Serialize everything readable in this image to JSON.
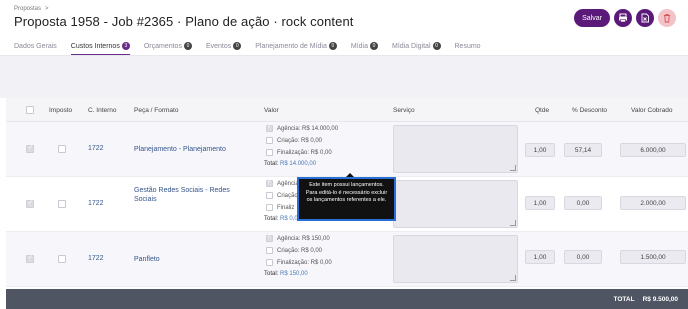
{
  "breadcrumb": {
    "label": "Propostas",
    "separator": ">"
  },
  "page": {
    "title": "Proposta 1958 - Job #2365 · Plano de ação · rock content"
  },
  "actions": {
    "save_label": "Salvar"
  },
  "tabs": [
    {
      "label": "Dados Gerais",
      "badge": ""
    },
    {
      "label": "Custos Internos",
      "badge": "3"
    },
    {
      "label": "Orçamentos",
      "badge": "0"
    },
    {
      "label": "Eventos",
      "badge": "0"
    },
    {
      "label": "Planejamento de Mídia",
      "badge": "0"
    },
    {
      "label": "Mídia",
      "badge": "0"
    },
    {
      "label": "Mídia Digital",
      "badge": "0"
    },
    {
      "label": "Resumo",
      "badge": ""
    }
  ],
  "table": {
    "headers": {
      "imposto": "Imposto",
      "c_interno": "C. Interno",
      "peca": "Peça / Formato",
      "valor": "Valor",
      "servico": "Serviço",
      "qtde": "Qtde",
      "desconto": "% Desconto",
      "valor_cobrado": "Valor Cobrado"
    },
    "rows": [
      {
        "code": "1722",
        "peca": "Planejamento - Planejamento",
        "agencia": "Agência: R$ 14.000,00",
        "criacao": "Criação: R$ 0,00",
        "finalizacao": "Finalização: R$ 0,00",
        "total_label": "Total:",
        "total": "R$ 14.000,00",
        "qtde": "1,00",
        "desconto": "57,14",
        "valor_cobrado": "6.000,00"
      },
      {
        "code": "1722",
        "peca": "Gestão Redes Sociais - Redes Sociais",
        "agencia": "Agência",
        "criacao": "Criação",
        "finalizacao": "Finaliz",
        "total_label": "Total:",
        "total": "R$ 0,0",
        "qtde": "1,00",
        "desconto": "0,00",
        "valor_cobrado": "2.000,00"
      },
      {
        "code": "1722",
        "peca": "Panfleto",
        "agencia": "Agência: R$ 150,00",
        "criacao": "Criação: R$ 0,00",
        "finalizacao": "Finalização: R$ 0,00",
        "total_label": "Total:",
        "total": "R$ 150,00",
        "qtde": "1,00",
        "desconto": "0,00",
        "valor_cobrado": "1.500,00"
      }
    ]
  },
  "footer": {
    "total_label": "TOTAL",
    "total_value": "R$ 9.500,00"
  },
  "tooltip": {
    "text": "Este item possui lançamentos. Para editá-lo é necessário excluir os lançamentos referentes a ele."
  },
  "colors": {
    "brand": "#5b1a7a",
    "danger_soft": "#f2c3c9",
    "link": "#34558b",
    "footer": "#4f5563"
  }
}
